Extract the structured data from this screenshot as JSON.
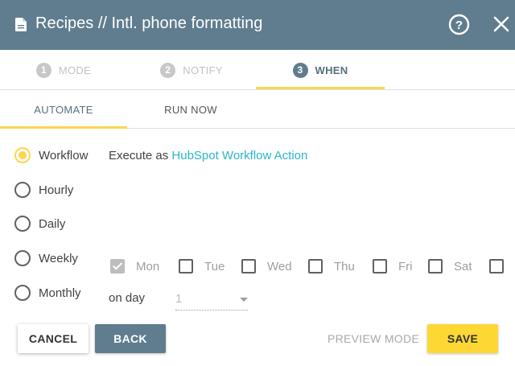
{
  "header": {
    "title": "Recipes // Intl. phone formatting",
    "doc_icon": "document-icon",
    "help_icon": "help-circle-icon",
    "close_icon": "close-icon"
  },
  "steps": [
    {
      "number": "1",
      "label": "MODE",
      "state": "inactive"
    },
    {
      "number": "2",
      "label": "NOTIFY",
      "state": "inactive"
    },
    {
      "number": "3",
      "label": "WHEN",
      "state": "active"
    }
  ],
  "subtabs": [
    {
      "label": "AUTOMATE",
      "active": true
    },
    {
      "label": "RUN NOW",
      "active": false
    }
  ],
  "schedule": {
    "options": [
      {
        "label": "Workflow",
        "checked": true
      },
      {
        "label": "Hourly",
        "checked": false
      },
      {
        "label": "Daily",
        "checked": false
      },
      {
        "label": "Weekly",
        "checked": false
      },
      {
        "label": "Monthly",
        "checked": false
      }
    ],
    "execute_prefix": "Execute as",
    "execute_link": "HubSpot Workflow Action"
  },
  "days": [
    {
      "label": "Mon",
      "checked": true
    },
    {
      "label": "Tue",
      "checked": false
    },
    {
      "label": "Wed",
      "checked": false
    },
    {
      "label": "Thu",
      "checked": false
    },
    {
      "label": "Fri",
      "checked": false
    },
    {
      "label": "Sat",
      "checked": false
    },
    {
      "label": "",
      "checked": false
    }
  ],
  "on_day": {
    "label": "on day",
    "value": "1"
  },
  "footer": {
    "cancel": "CANCEL",
    "back": "BACK",
    "preview": "PREVIEW MODE",
    "save": "SAVE"
  },
  "colors": {
    "header_bg": "#5f7d8e",
    "accent_yellow": "#ffd54f",
    "link": "#29b6c9",
    "save_bg": "#fdd835"
  }
}
